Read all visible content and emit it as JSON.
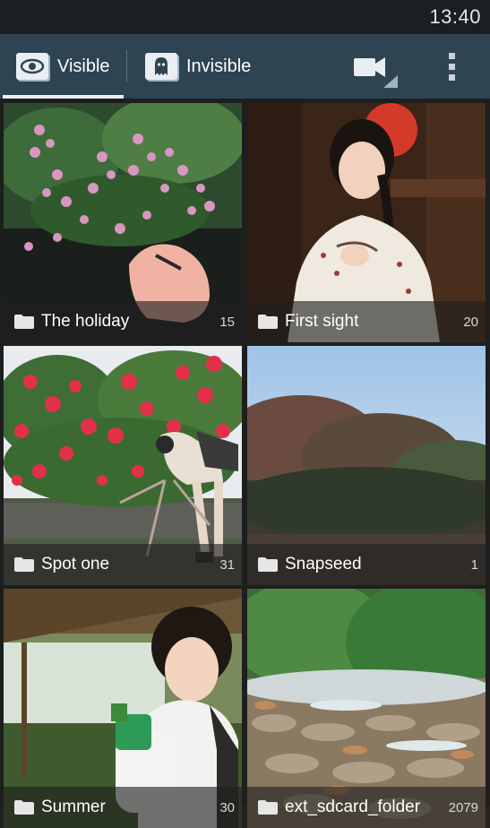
{
  "status_bar": {
    "time": "13:40"
  },
  "action_bar": {
    "tabs": [
      {
        "label": "Visible",
        "icon": "eye-icon",
        "selected": true
      },
      {
        "label": "Invisible",
        "icon": "ghost-icon",
        "selected": false
      }
    ],
    "actions": [
      {
        "icon": "video-camera-icon"
      },
      {
        "icon": "overflow-menu-icon"
      }
    ]
  },
  "albums": [
    {
      "name": "The holiday",
      "count": "15"
    },
    {
      "name": "First sight",
      "count": "20"
    },
    {
      "name": "Spot one",
      "count": "31"
    },
    {
      "name": "Snapseed",
      "count": "1"
    },
    {
      "name": "Summer",
      "count": "30"
    },
    {
      "name": "ext_sdcard_folder",
      "count": "2079"
    }
  ],
  "colors": {
    "status_bar": "#1a1f24",
    "action_bar": "#2e4453",
    "tab_indicator": "#e8eef2"
  }
}
